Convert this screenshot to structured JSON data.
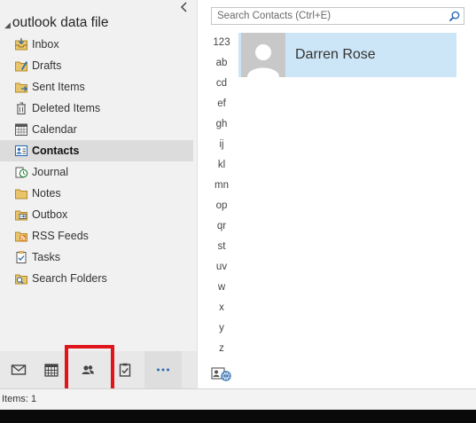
{
  "mailbox": {
    "title": "outlook data file"
  },
  "folders": [
    {
      "label": "Inbox",
      "icon": "inbox-icon"
    },
    {
      "label": "Drafts",
      "icon": "drafts-icon"
    },
    {
      "label": "Sent Items",
      "icon": "sent-items-icon"
    },
    {
      "label": "Deleted Items",
      "icon": "deleted-items-icon"
    },
    {
      "label": "Calendar",
      "icon": "calendar-icon"
    },
    {
      "label": "Contacts",
      "icon": "contacts-icon",
      "selected": true
    },
    {
      "label": "Journal",
      "icon": "journal-icon"
    },
    {
      "label": "Notes",
      "icon": "notes-icon"
    },
    {
      "label": "Outbox",
      "icon": "outbox-icon"
    },
    {
      "label": "RSS Feeds",
      "icon": "rss-feeds-icon"
    },
    {
      "label": "Tasks",
      "icon": "tasks-icon"
    },
    {
      "label": "Search Folders",
      "icon": "search-folders-icon"
    }
  ],
  "nav": [
    {
      "name": "mail",
      "icon": "mail-icon"
    },
    {
      "name": "calendar",
      "icon": "calendar-grid-icon"
    },
    {
      "name": "people",
      "icon": "people-icon",
      "highlighted": true
    },
    {
      "name": "tasks",
      "icon": "tasks-clipboard-icon"
    },
    {
      "name": "more",
      "icon": "ellipsis-icon"
    }
  ],
  "search": {
    "placeholder": "Search Contacts (Ctrl+E)"
  },
  "alpha_index": [
    "123",
    "ab",
    "cd",
    "ef",
    "gh",
    "ij",
    "kl",
    "mn",
    "op",
    "qr",
    "st",
    "uv",
    "w",
    "x",
    "y",
    "z"
  ],
  "contacts": [
    {
      "name": "Darren Rose"
    }
  ],
  "status": {
    "items": "Items: 1"
  },
  "colors": {
    "selected_card": "#cde6f7",
    "highlight_box": "#e0151b",
    "nav_accent": "#2b6cb0"
  }
}
